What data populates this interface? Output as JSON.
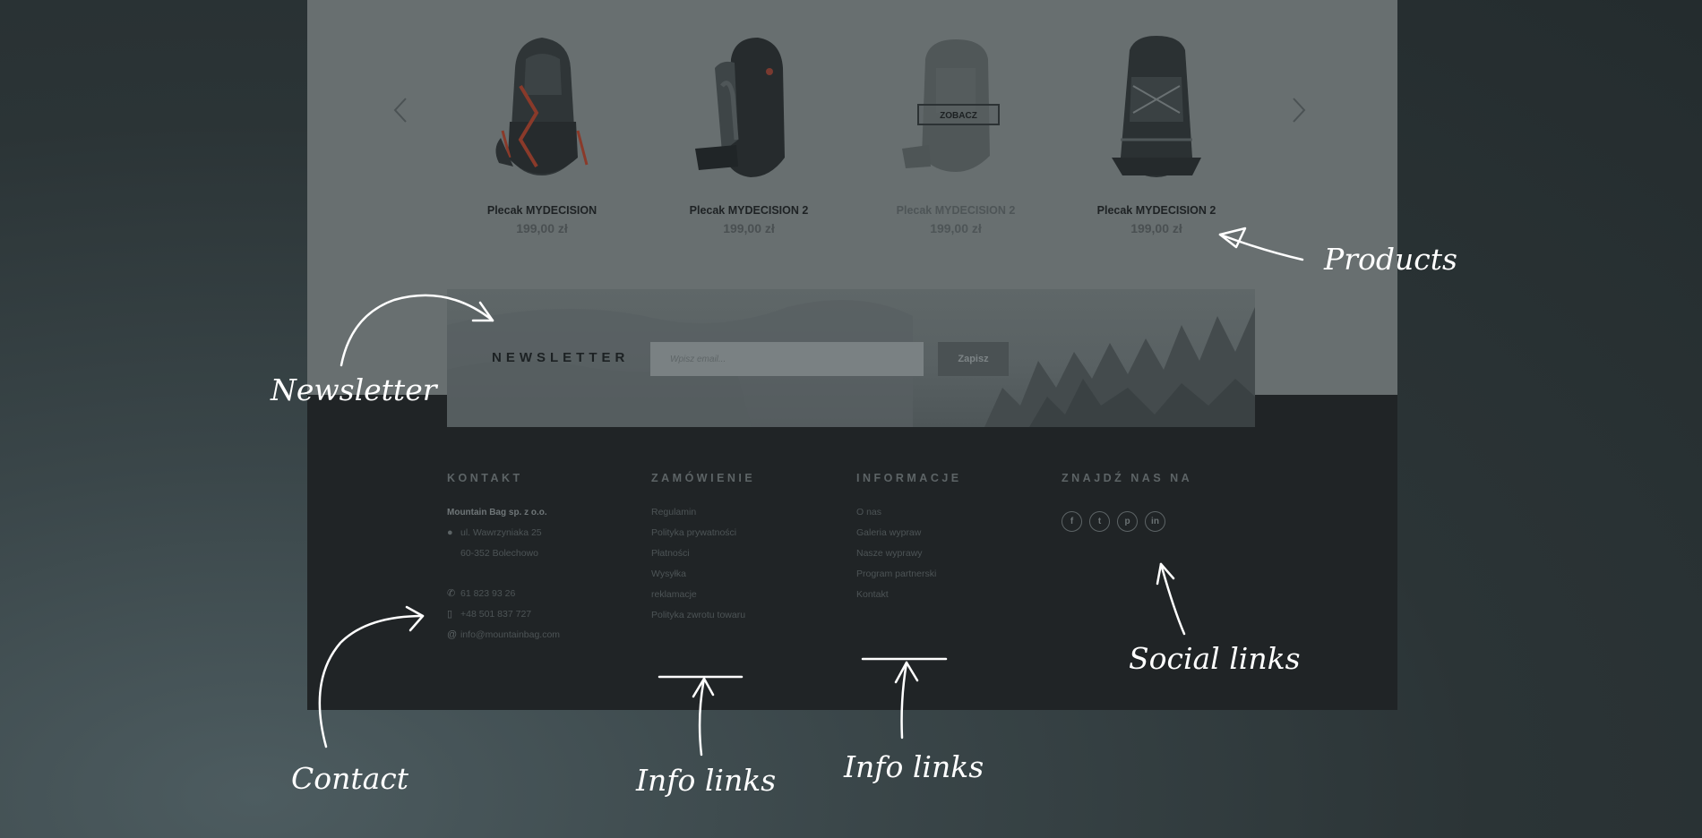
{
  "carousel": {
    "prev_icon": "chevron-left-icon",
    "next_icon": "chevron-right-icon",
    "products": [
      {
        "name": "Plecak MYDECISION",
        "price": "199,00 zł"
      },
      {
        "name": "Plecak MYDECISION 2",
        "price": "199,00 zł"
      },
      {
        "name": "Plecak MYDECISION 2",
        "price": "199,00 zł",
        "hover_button": "ZOBACZ"
      },
      {
        "name": "Plecak MYDECISION 2",
        "price": "199,00 zł"
      }
    ]
  },
  "newsletter": {
    "title": "NEWSLETTER",
    "placeholder": "Wpisz email...",
    "button": "Zapisz"
  },
  "footer": {
    "kontakt": {
      "title": "KONTAKT",
      "company": "Mountain Bag sp. z o.o.",
      "address1": "ul. Wawrzyniaka 25",
      "address2": "60-352 Bolechowo",
      "phone": "61 823 93 26",
      "mobile": "+48 501 837 727",
      "email": "info@mountainbag.com"
    },
    "zamowienie": {
      "title": "ZAMÓWIENIE",
      "links": [
        "Regulamin",
        "Polityka prywatności",
        "Płatności",
        "Wysyłka",
        "reklamacje",
        "Polityka zwrotu towaru"
      ]
    },
    "informacje": {
      "title": "INFORMACJE",
      "links": [
        "O nas",
        "Galeria wypraw",
        "Nasze wyprawy",
        "Program partnerski",
        "Kontakt"
      ]
    },
    "social": {
      "title": "ZNAJDŹ NAS NA",
      "icons": [
        "facebook-icon",
        "twitter-icon",
        "pinterest-icon",
        "linkedin-icon"
      ],
      "glyphs": [
        "f",
        "t",
        "p",
        "in"
      ]
    }
  },
  "annotations": {
    "products": "Products",
    "newsletter": "Newsletter",
    "contact": "Contact",
    "info_links_1": "Info links",
    "info_links_2": "Info links",
    "social_links": "Social links"
  },
  "colors": {
    "products_bg": "#686f70",
    "footer_bg": "#202426",
    "annotation": "#ffffff"
  }
}
